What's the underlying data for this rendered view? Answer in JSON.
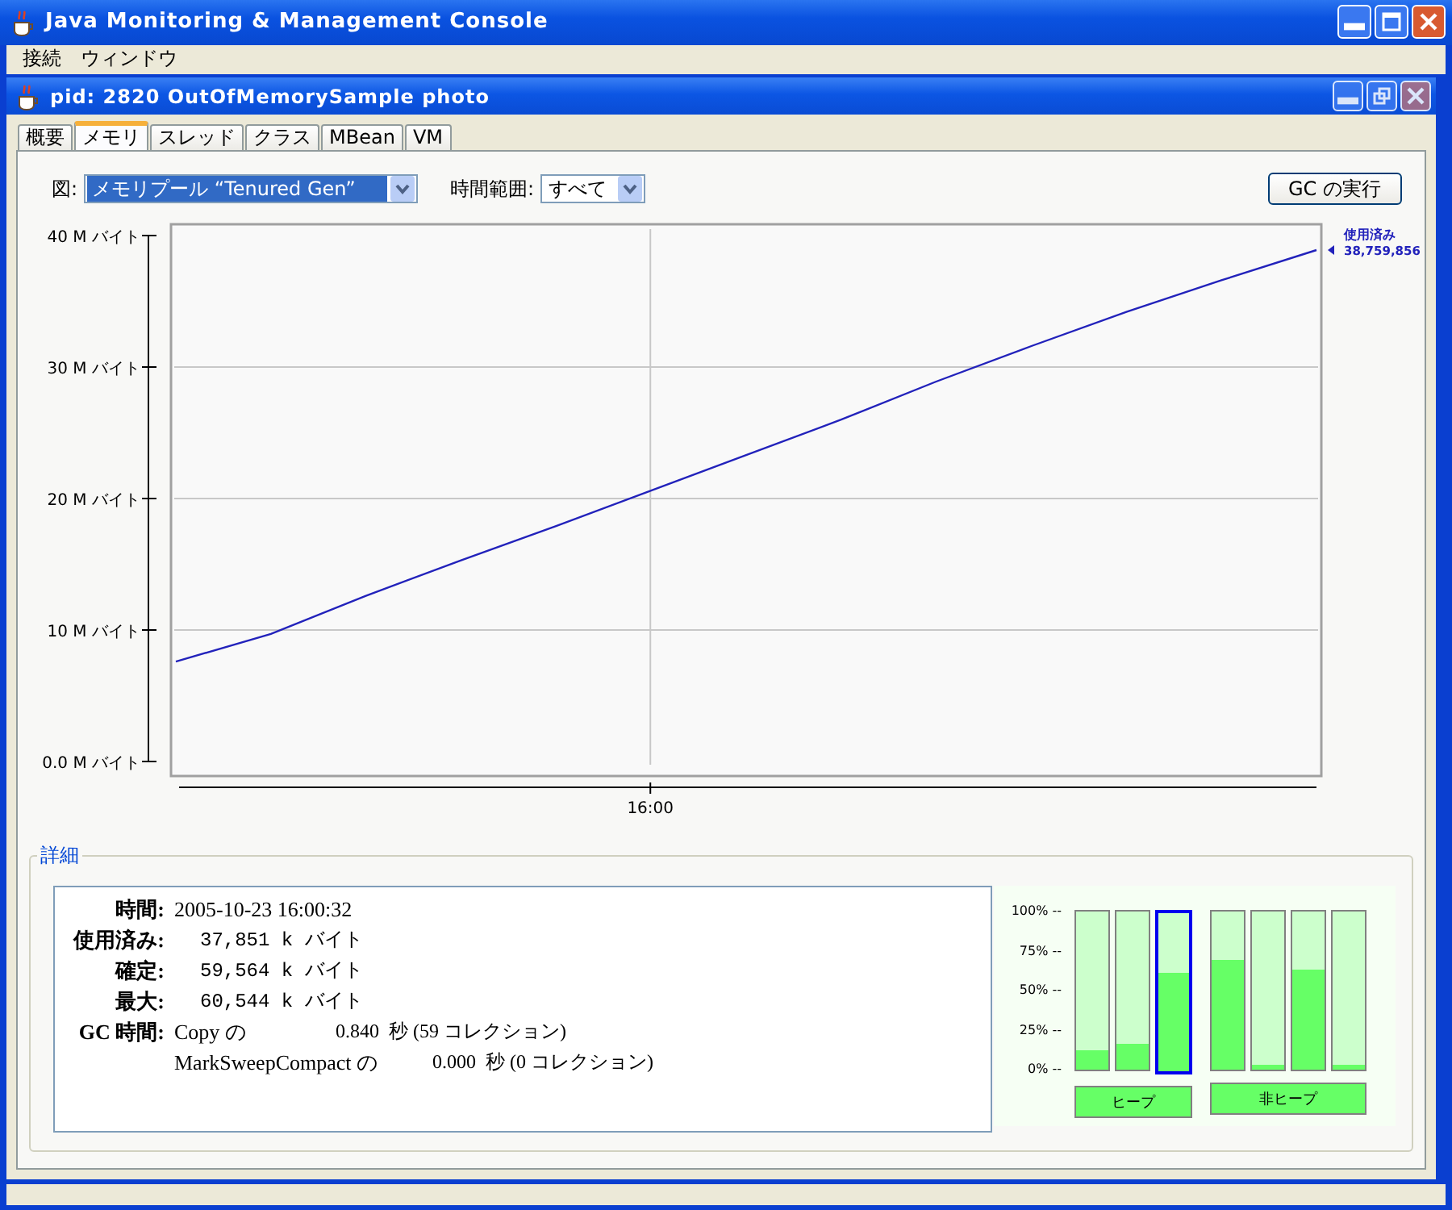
{
  "window": {
    "title": "Java Monitoring & Management Console"
  },
  "menu": [
    {
      "label": "接続"
    },
    {
      "label": "ウィンドウ"
    }
  ],
  "frame": {
    "title": "pid: 2820 OutOfMemorySample photo"
  },
  "tabs": [
    {
      "label": "概要",
      "selected": false
    },
    {
      "label": "メモリ",
      "selected": true
    },
    {
      "label": "スレッド",
      "selected": false
    },
    {
      "label": "クラス",
      "selected": false
    },
    {
      "label": "MBean",
      "selected": false
    },
    {
      "label": "VM",
      "selected": false
    }
  ],
  "controls": {
    "chart_label": "図:",
    "chart_value": "メモリプール “Tenured Gen”",
    "range_label": "時間範囲:",
    "range_value": "すべて",
    "gc_button": "GC の実行"
  },
  "chart": {
    "legend": {
      "value": "38,759,856"
    },
    "chart_data": {
      "type": "line",
      "grid": true,
      "ylim": [
        0,
        40
      ],
      "annotations": [
        {
          "text": "16:00"
        }
      ],
      "yticks": [
        {
          "value": 0,
          "label": "0.0 M バイト"
        },
        {
          "value": 10,
          "label": "10 M バイト"
        },
        {
          "value": 20,
          "label": "20 M バイト"
        },
        {
          "value": 30,
          "label": "30 M バイト"
        },
        {
          "value": 40,
          "label": "40 M バイト"
        }
      ],
      "series": [
        {
          "name": "使用済み",
          "color": "#2222bb",
          "values": [
            7.6,
            9.7,
            12.6,
            15.3,
            17.9,
            20.6,
            23.3,
            26.0,
            28.9,
            31.6,
            34.2,
            36.6,
            38.9
          ]
        }
      ]
    }
  },
  "details": {
    "title": "詳細",
    "rows": [
      {
        "label": "時間:",
        "value": "2005-10-23 16:00:32"
      },
      {
        "label": "使用済み:",
        "value": "37,851 k バイト"
      },
      {
        "label": "確定:",
        "value": "59,564 k バイト"
      },
      {
        "label": "最大:",
        "value": "60,544 k バイト"
      }
    ],
    "gc": {
      "label": "GC 時間:",
      "entries": [
        {
          "collector": "Copy の",
          "time": "0.840  秒 (59 コレクション)"
        },
        {
          "collector": "MarkSweepCompact の",
          "time": "0.000  秒 (0 コレクション)"
        }
      ]
    }
  },
  "pools": {
    "scale": [
      "100% --",
      "75% --",
      "50% --",
      "25% --",
      "0% --"
    ],
    "groups": [
      {
        "label": "ヒープ",
        "bars": [
          {
            "level": 0.12,
            "selected": false
          },
          {
            "level": 0.16,
            "selected": false
          },
          {
            "level": 0.62,
            "selected": true
          }
        ]
      },
      {
        "label": "非ヒープ",
        "bars": [
          {
            "level": 0.7,
            "selected": false
          },
          {
            "level": 0.03,
            "selected": false
          },
          {
            "level": 0.63,
            "selected": false
          },
          {
            "level": 0.03,
            "selected": false
          }
        ]
      }
    ]
  }
}
